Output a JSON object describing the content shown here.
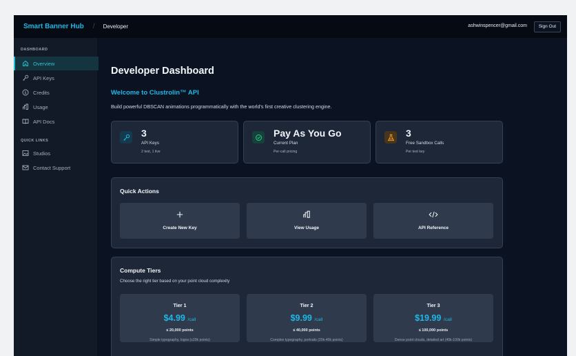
{
  "header": {
    "brand": "Smart Banner Hub",
    "separator": "/",
    "breadcrumb": "Developer",
    "email": "ashwinspencer@gmail.com",
    "sign_out": "Sign Out"
  },
  "sidebar": {
    "dashboard_title": "DASHBOARD",
    "items": [
      {
        "label": "Overview",
        "icon": "home-icon",
        "active": true
      },
      {
        "label": "API Keys",
        "icon": "key-icon"
      },
      {
        "label": "Credits",
        "icon": "dollar-icon"
      },
      {
        "label": "Usage",
        "icon": "bar-chart-icon"
      },
      {
        "label": "API Docs",
        "icon": "book-icon"
      }
    ],
    "quick_links_title": "QUICK LINKS",
    "links": [
      {
        "label": "Studios",
        "icon": "image-icon"
      },
      {
        "label": "Contact Support",
        "icon": "mail-icon"
      }
    ]
  },
  "main": {
    "title": "Developer Dashboard",
    "welcome": "Welcome to Clustrolin™ API",
    "description": "Build powerful DBSCAN animations programmatically with the world's first creative clustering engine.",
    "stats": [
      {
        "value": "3",
        "label": "API Keys",
        "sub": "2 test, 1 live",
        "icon": "key-icon",
        "color": "#1fb8e6"
      },
      {
        "value": "Pay As You Go",
        "label": "Current Plan",
        "sub": "Per-call pricing",
        "icon": "check-circle-icon",
        "color": "#2ecc8f"
      },
      {
        "value": "3",
        "label": "Free Sandbox Calls",
        "sub": "Per test key",
        "icon": "flask-icon",
        "color": "#f0a020"
      }
    ],
    "quick_actions": {
      "title": "Quick Actions",
      "items": [
        {
          "label": "Create New Key",
          "icon": "plus-icon"
        },
        {
          "label": "View Usage",
          "icon": "bar-chart-icon"
        },
        {
          "label": "API Reference",
          "icon": "code-icon"
        }
      ]
    },
    "compute_tiers": {
      "title": "Compute Tiers",
      "subtitle": "Choose the right tier based on your point cloud complexity",
      "tiers": [
        {
          "name": "Tier 1",
          "price": "$4.99",
          "per": "/call",
          "points": "≤ 20,000 points",
          "desc": "Simple typography, logos (≤20k points)"
        },
        {
          "name": "Tier 2",
          "price": "$9.99",
          "per": "/call",
          "points": "≤ 40,000 points",
          "desc": "Complex typography, portraits (20k-40k points)"
        },
        {
          "name": "Tier 3",
          "price": "$19.99",
          "per": "/call",
          "points": "≤ 100,000 points",
          "desc": "Dense point clouds, detailed art (40k-100k points)"
        }
      ]
    }
  },
  "colors": {
    "accent": "#1fb8e6",
    "background": "#0b1322",
    "card": "#1d2738",
    "tile": "#2f3a4d"
  }
}
